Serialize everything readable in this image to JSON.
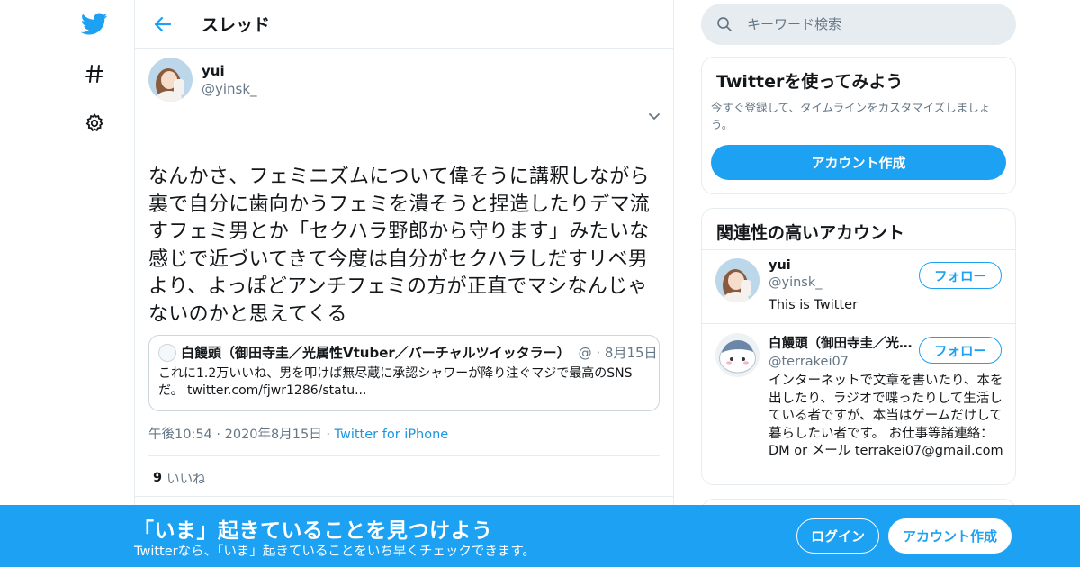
{
  "brand": {
    "accent": "#1da1f2",
    "text": "#14171a",
    "muted": "#657786",
    "border": "#e6ecf0"
  },
  "nav": {
    "items": [
      {
        "icon": "twitter-bird-icon"
      },
      {
        "icon": "hashtag-icon"
      },
      {
        "icon": "gear-icon"
      }
    ]
  },
  "thread": {
    "title": "スレッド",
    "tweet": {
      "display_name": "yui",
      "screen_name": "@yinsk_",
      "text": "なんかさ、フェミニズムについて偉そうに講釈しながら裏で自分に歯向かうフェミを潰そうと捏造したりデマ流すフェミ男とか「セクハラ野郎から守ります」みたいな感じで近づいてきて今度は自分がセクハラしだすリベ男より、よっぽどアンチフェミの方が正直でマシなんじゃないのかと思えてくる",
      "quote": {
        "display_name": "白饅頭（御田寺圭／光属性Vtuber／バーチャルツイッタラー）",
        "meta": "@ · 8月15日",
        "text": "これに1.2万いいね、男を叩けば無尽蔵に承認シャワーが降り注ぐマジで最高のSNSだ。 twitter.com/fjwr1286/statu..."
      },
      "time": "午後10:54",
      "date": "2020年8月15日",
      "source": "Twitter for iPhone",
      "likes_count": "9",
      "likes_label": "いいね"
    }
  },
  "sidebar": {
    "search_placeholder": "キーワード検索",
    "signup_card": {
      "title": "Twitterを使ってみよう",
      "description": "今すぐ登録して、タイムラインをカスタマイズしましょう。",
      "button": "アカウント作成"
    },
    "related": {
      "title": "関連性の高いアカウント",
      "users": [
        {
          "display_name": "yui",
          "screen_name": "@yinsk_",
          "bio": "This is Twitter",
          "follow": "フォロー"
        },
        {
          "display_name": "白饅頭（御田寺圭／光属性Vtuber／バーチャルツイッタラー）",
          "screen_name": "@terrakei07",
          "bio": "インターネットで文章を書いたり、本を出したり、ラジオで喋ったりして生活している者ですが、本当はゲームだけして暮らしたい者です。 お仕事等諸連絡：DM or メール terrakei07@gmail.com",
          "follow": "フォロー"
        }
      ]
    }
  },
  "banner": {
    "title": "「いま」起きていることを見つけよう",
    "subtitle": "Twitterなら、「いま」起きていることをいち早くチェックできます。",
    "login": "ログイン",
    "signup": "アカウント作成"
  }
}
